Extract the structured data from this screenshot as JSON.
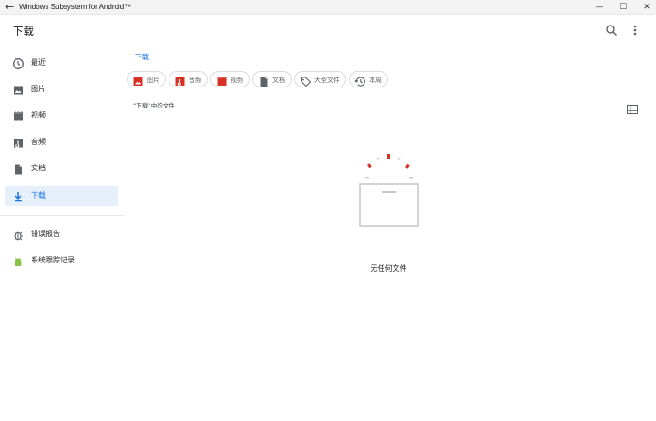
{
  "window": {
    "title": "Windows Subsystem for Android™",
    "back_glyph": "←",
    "min_glyph": "—",
    "max_glyph": "☐",
    "close_glyph": "✕"
  },
  "appbar": {
    "title": "下载",
    "search_icon": "search-icon",
    "more_icon": "more-vertical-icon"
  },
  "sidebar": {
    "items": [
      {
        "label": "最近",
        "icon": "clock-icon"
      },
      {
        "label": "图片",
        "icon": "image-icon"
      },
      {
        "label": "视频",
        "icon": "video-icon"
      },
      {
        "label": "音频",
        "icon": "audio-icon"
      },
      {
        "label": "文档",
        "icon": "document-icon"
      },
      {
        "label": "下载",
        "icon": "download-icon",
        "selected": true
      }
    ],
    "extra_items": [
      {
        "label": "错误报告",
        "icon": "bug-icon"
      },
      {
        "label": "系统跟踪记录",
        "icon": "android-icon"
      }
    ]
  },
  "breadcrumb": {
    "label": "下载"
  },
  "filter_chips": [
    {
      "label": "图片",
      "icon": "image-icon"
    },
    {
      "label": "音频",
      "icon": "audio-icon"
    },
    {
      "label": "视频",
      "icon": "video-icon"
    },
    {
      "label": "文档",
      "icon": "document-icon"
    },
    {
      "label": "大型文件",
      "icon": "tag-icon"
    },
    {
      "label": "本周",
      "icon": "history-icon"
    }
  ],
  "content": {
    "section_label": "“下载”中的文件",
    "view_toggle_icon": "list-view-icon",
    "empty_message": "无任何文件"
  },
  "colors": {
    "accent": "#1a73e8",
    "selected_bg": "#e6f0fb",
    "chip_icon_red": "#d93025"
  }
}
